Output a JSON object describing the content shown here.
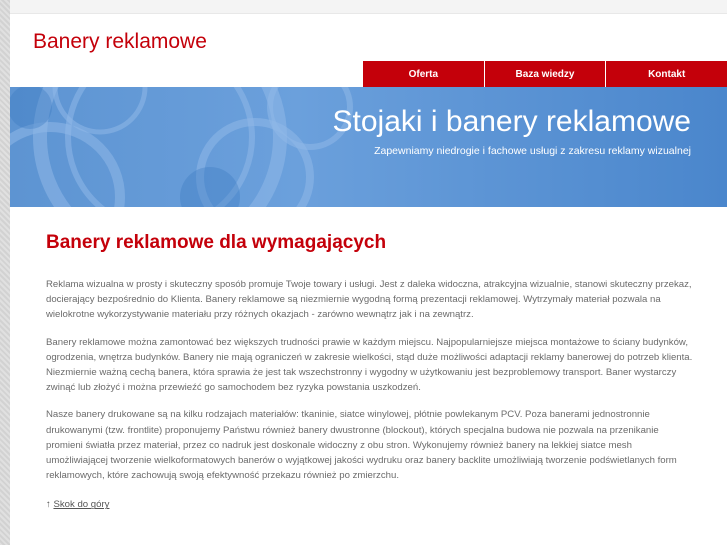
{
  "header": {
    "site_title": "Banery reklamowe"
  },
  "nav": {
    "items": [
      {
        "label": "Oferta"
      },
      {
        "label": "Baza wiedzy"
      },
      {
        "label": "Kontakt"
      }
    ]
  },
  "banner": {
    "title": "Stojaki i banery reklamowe",
    "subtitle": "Zapewniamy niedrogie i fachowe usługi z zakresu reklamy wizualnej"
  },
  "main": {
    "heading": "Banery reklamowe dla wymagających",
    "paragraphs": [
      "Reklama wizualna w prosty i skuteczny sposób promuje Twoje towary i usługi. Jest z daleka widoczna, atrakcyjna wizualnie, stanowi skuteczny przekaz, docierający bezpośrednio do Klienta. Banery reklamowe są niezmiernie wygodną formą prezentacji reklamowej. Wytrzymały materiał pozwala na wielokrotne wykorzystywanie materiału przy różnych okazjach - zarówno wewnątrz jak i na zewnątrz.",
      "Banery reklamowe można zamontować bez większych trudności prawie w każdym miejscu. Najpopularniejsze miejsca montażowe to ściany budynków, ogrodzenia, wnętrza budynków. Banery nie mają ograniczeń w zakresie wielkości, stąd duże możliwości adaptacji reklamy banerowej do potrzeb klienta. Niezmiernie ważną cechą banera, która sprawia że jest tak wszechstronny i wygodny w użytkowaniu jest bezproblemowy transport. Baner wystarczy zwinąć lub złożyć i można przewieźć go samochodem bez ryzyka powstania uszkodzeń.",
      "Nasze banery drukowane są na kilku rodzajach materiałów: tkaninie, siatce winylowej, płótnie powlekanym PCV. Poza banerami jednostronnie drukowanymi (tzw. frontlite) proponujemy Państwu również banery dwustronne (blockout), których specjalna budowa nie pozwala na przenikanie promieni światła przez materiał, przez co nadruk jest doskonale widoczny z obu stron. Wykonujemy również banery na lekkiej siatce mesh umożliwiającej tworzenie wielkoformatowych banerów o wyjątkowej jakości wydruku oraz banery backlite umożliwiają tworzenie podświetlanych form reklamowych, które zachowują swoją efektywność przekazu również po zmierzchu."
    ],
    "back_to_top_arrow": "↑",
    "back_to_top_label": "Skok do góry"
  },
  "colors": {
    "accent": "#c4000a",
    "banner": "#5d94d2",
    "text": "#6b6b6b"
  }
}
